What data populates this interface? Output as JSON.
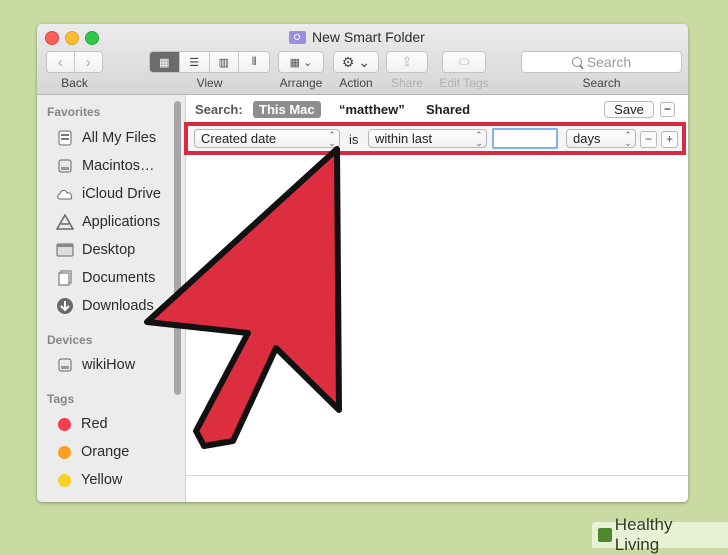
{
  "window": {
    "title": "New Smart Folder"
  },
  "toolbar": {
    "back_label": "Back",
    "view_label": "View",
    "arrange_label": "Arrange",
    "action_label": "Action",
    "share_label": "Share",
    "edit_tags_label": "Edit Tags",
    "search_placeholder": "Search",
    "search_label": "Search"
  },
  "sidebar": {
    "favorites_heading": "Favorites",
    "favorites": [
      {
        "label": "All My Files",
        "icon": "all-files-icon"
      },
      {
        "label": "Macintos…",
        "icon": "hard-drive-icon"
      },
      {
        "label": "iCloud Drive",
        "icon": "cloud-icon"
      },
      {
        "label": "Applications",
        "icon": "applications-icon"
      },
      {
        "label": "Desktop",
        "icon": "desktop-icon"
      },
      {
        "label": "Documents",
        "icon": "documents-icon"
      },
      {
        "label": "Downloads",
        "icon": "downloads-icon"
      }
    ],
    "devices_heading": "Devices",
    "devices": [
      {
        "label": "wikiHow",
        "icon": "hard-drive-icon"
      }
    ],
    "tags_heading": "Tags",
    "tags": [
      {
        "label": "Red",
        "color": "#f1404b"
      },
      {
        "label": "Orange",
        "color": "#f6a121"
      },
      {
        "label": "Yellow",
        "color": "#f7d02a"
      }
    ]
  },
  "search_bar": {
    "label": "Search:",
    "scopes": [
      "This Mac",
      "“matthew”",
      "Shared"
    ],
    "active_scope": "This Mac",
    "save_label": "Save"
  },
  "criteria": {
    "attribute": "Created date",
    "connector": "is",
    "operator": "within last",
    "value": "",
    "unit": "days"
  },
  "highlight_color": "#d62b40",
  "watermark": {
    "text": "Healthy Living"
  }
}
